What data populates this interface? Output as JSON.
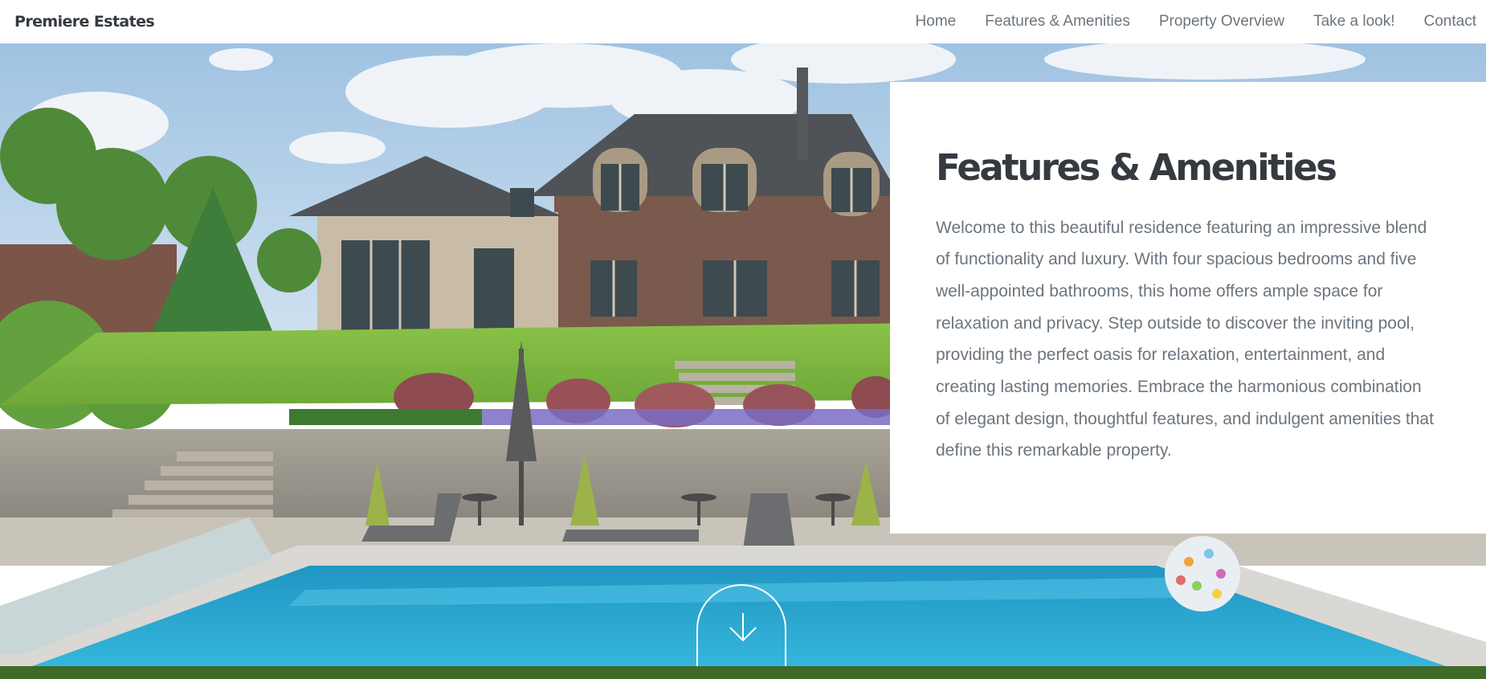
{
  "navbar": {
    "brand": "Premiere Estates",
    "links": [
      "Home",
      "Features & Amenities",
      "Property Overview",
      "Take a look!",
      "Contact"
    ]
  },
  "feature": {
    "heading": "Features & Amenities",
    "text": "Welcome to this beautiful residence featuring an impressive blend of functionality and luxury. With four spacious bedrooms and five well-appointed bathrooms, this home offers ample space for relaxation and privacy. Step outside to discover the inviting pool, providing the perfect oasis for relaxation, entertainment, and creating lasting memories. Embrace the harmonious combination of elegant design, thoughtful features, and indulgent amenities that define this remarkable property."
  },
  "scroll": {
    "icon": "arrow-down-icon"
  },
  "colors": {
    "heading": "#343a40",
    "body_text": "#6c757d",
    "pool": "#2aa8d0",
    "lawn": "#7fb83f",
    "sky": "#b7d3ea"
  }
}
